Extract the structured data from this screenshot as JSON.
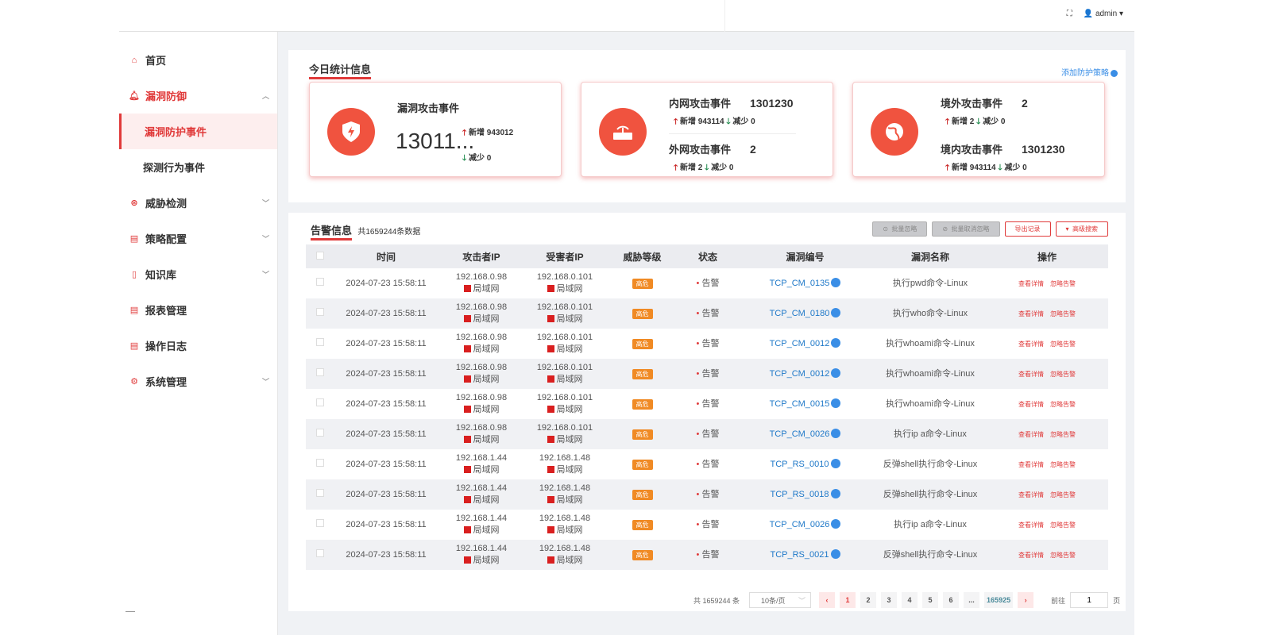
{
  "header": {
    "user": "admin"
  },
  "sidebar": {
    "items": [
      {
        "label": "首页",
        "icon": "home-icon"
      },
      {
        "label": "漏洞防御",
        "icon": "bell-icon",
        "sub": [
          "漏洞防护事件",
          "探测行为事件"
        ]
      },
      {
        "label": "威胁检测",
        "icon": "threat-icon"
      },
      {
        "label": "策略配置",
        "icon": "policy-icon"
      },
      {
        "label": "知识库",
        "icon": "book-icon"
      },
      {
        "label": "报表管理",
        "icon": "report-icon"
      },
      {
        "label": "操作日志",
        "icon": "log-icon"
      },
      {
        "label": "系统管理",
        "icon": "settings-icon"
      }
    ]
  },
  "stats": {
    "title": "今日统计信息",
    "add_policy": "添加防护策略",
    "card1": {
      "label": "漏洞攻击事件",
      "value": "13011...",
      "inc": "新增 943012",
      "dec": "减少 0"
    },
    "card2": {
      "a_label": "内网攻击事件",
      "a_value": "1301230",
      "a_inc": "新增 943114",
      "a_dec": "减少 0",
      "b_label": "外网攻击事件",
      "b_value": "2",
      "b_inc": "新增 2",
      "b_dec": "减少 0"
    },
    "card3": {
      "a_label": "境外攻击事件",
      "a_value": "2",
      "a_inc": "新增 2",
      "a_dec": "减少 0",
      "b_label": "境内攻击事件",
      "b_value": "1301230",
      "b_inc": "新增 943114",
      "b_dec": "减少 0"
    }
  },
  "alerts": {
    "title": "告警信息",
    "count": "共1659244条数据",
    "buttons": {
      "ignore": "批量忽略",
      "unignore": "批量取消忽略",
      "export": "导出记录",
      "advanced": "高级搜索"
    },
    "columns": [
      "时间",
      "攻击者IP",
      "受害者IP",
      "威胁等级",
      "状态",
      "漏洞编号",
      "漏洞名称",
      "操作"
    ],
    "rows": [
      {
        "time": "2024-07-23 15:58:11",
        "src": "192.168.0.98",
        "dst": "192.168.0.101",
        "id": "TCP_CM_0135",
        "name": "执行pwd命令-Linux"
      },
      {
        "time": "2024-07-23 15:58:11",
        "src": "192.168.0.98",
        "dst": "192.168.0.101",
        "id": "TCP_CM_0180",
        "name": "执行who命令-Linux"
      },
      {
        "time": "2024-07-23 15:58:11",
        "src": "192.168.0.98",
        "dst": "192.168.0.101",
        "id": "TCP_CM_0012",
        "name": "执行whoami命令-Linux"
      },
      {
        "time": "2024-07-23 15:58:11",
        "src": "192.168.0.98",
        "dst": "192.168.0.101",
        "id": "TCP_CM_0012",
        "name": "执行whoami命令-Linux"
      },
      {
        "time": "2024-07-23 15:58:11",
        "src": "192.168.0.98",
        "dst": "192.168.0.101",
        "id": "TCP_CM_0015",
        "name": "执行whoami命令-Linux"
      },
      {
        "time": "2024-07-23 15:58:11",
        "src": "192.168.0.98",
        "dst": "192.168.0.101",
        "id": "TCP_CM_0026",
        "name": "执行ip a命令-Linux"
      },
      {
        "time": "2024-07-23 15:58:11",
        "src": "192.168.1.44",
        "dst": "192.168.1.48",
        "id": "TCP_RS_0010",
        "name": "反弹shell执行命令-Linux"
      },
      {
        "time": "2024-07-23 15:58:11",
        "src": "192.168.1.44",
        "dst": "192.168.1.48",
        "id": "TCP_RS_0018",
        "name": "反弹shell执行命令-Linux"
      },
      {
        "time": "2024-07-23 15:58:11",
        "src": "192.168.1.44",
        "dst": "192.168.1.48",
        "id": "TCP_CM_0026",
        "name": "执行ip a命令-Linux"
      },
      {
        "time": "2024-07-23 15:58:11",
        "src": "192.168.1.44",
        "dst": "192.168.1.48",
        "id": "TCP_RS_0021",
        "name": "反弹shell执行命令-Linux"
      }
    ],
    "row_common": {
      "net": "局域网",
      "level": "高危",
      "status": "告警",
      "op_view": "查看详情",
      "op_ignore": "忽略告警"
    },
    "pagination": {
      "total": "共 1659244 条",
      "page_size": "10条/页",
      "pages": [
        "1",
        "2",
        "3",
        "4",
        "5",
        "6",
        "...",
        "165925"
      ],
      "goto_label": "前往",
      "goto_value": "1",
      "page_suffix": "页"
    }
  }
}
